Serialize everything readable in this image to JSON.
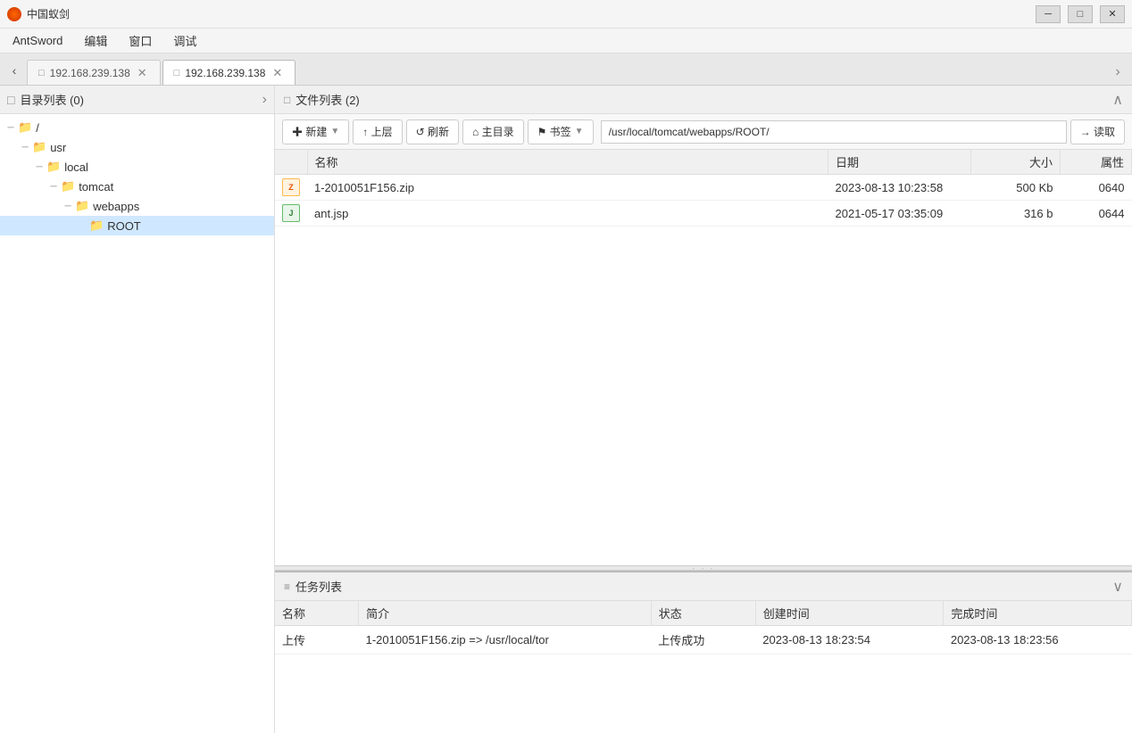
{
  "titleBar": {
    "appName": "中国蚁剑",
    "minBtn": "─",
    "maxBtn": "□",
    "closeBtn": "✕"
  },
  "menuBar": {
    "items": [
      "AntSword",
      "编辑",
      "窗口",
      "调试"
    ]
  },
  "tabBar": {
    "tabs": [
      {
        "id": "tab1",
        "icon": "□",
        "label": "192.168.239.138",
        "active": false
      },
      {
        "id": "tab2",
        "icon": "□",
        "label": "192.168.239.138",
        "active": true
      }
    ],
    "moreBtn": "›"
  },
  "sidebar": {
    "header": "目录列表 (0)",
    "tree": [
      {
        "level": 0,
        "indent": 4,
        "toggle": "─",
        "folder": true,
        "label": "/",
        "expanded": true
      },
      {
        "level": 1,
        "indent": 20,
        "toggle": "─",
        "folder": true,
        "label": "usr",
        "expanded": true
      },
      {
        "level": 2,
        "indent": 36,
        "toggle": "─",
        "folder": true,
        "label": "local",
        "expanded": true
      },
      {
        "level": 3,
        "indent": 52,
        "toggle": "─",
        "folder": true,
        "label": "tomcat",
        "expanded": true
      },
      {
        "level": 4,
        "indent": 68,
        "toggle": "─",
        "folder": true,
        "label": "webapps",
        "expanded": true
      },
      {
        "level": 5,
        "indent": 84,
        "toggle": " ",
        "folder": true,
        "label": "ROOT",
        "expanded": false
      }
    ]
  },
  "filePanel": {
    "header": "文件列表 (2)",
    "toolbar": {
      "newBtn": "✚ 新建",
      "upBtn": "↑ 上层",
      "refreshBtn": "↺ 刷新",
      "homeBtn": "⌂ 主目录",
      "bookmarkBtn": "⚑ 书签",
      "pathValue": "/usr/local/tomcat/webapps/ROOT/",
      "readBtn": "→ 读取"
    },
    "tableHeaders": [
      "",
      "名称",
      "日期",
      "大小",
      "属性"
    ],
    "files": [
      {
        "type": "zip",
        "name": "1-2010051F156.zip",
        "date": "2023-08-13 10:23:58",
        "size": "500 Kb",
        "perm": "0640"
      },
      {
        "type": "jsp",
        "name": "ant.jsp",
        "date": "2021-05-17 03:35:09",
        "size": "316 b",
        "perm": "0644"
      }
    ]
  },
  "taskPanel": {
    "header": "任务列表",
    "tableHeaders": [
      "名称",
      "简介",
      "状态",
      "创建时间",
      "完成时间"
    ],
    "tasks": [
      {
        "name": "上传",
        "desc": "1-2010051F156.zip => /usr/local/tor",
        "status": "上传成功",
        "created": "2023-08-13 18:23:54",
        "completed": "2023-08-13 18:23:56"
      }
    ]
  }
}
